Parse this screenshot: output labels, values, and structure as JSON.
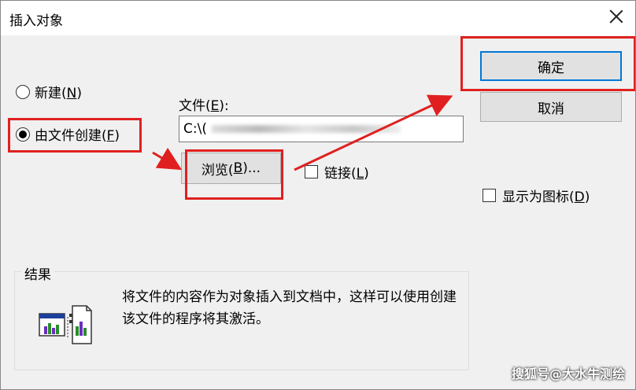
{
  "window": {
    "title": "插入对象"
  },
  "options": {
    "new_label": "新建(",
    "new_key": "N",
    "new_suffix": ")",
    "from_file_label": "由文件创建(",
    "from_file_key": "F",
    "from_file_suffix": ")"
  },
  "file": {
    "label_prefix": "文件(",
    "label_key": "E",
    "label_suffix": "):",
    "value": "C:\\("
  },
  "buttons": {
    "browse_prefix": "浏览(",
    "browse_key": "B",
    "browse_suffix": ")...",
    "ok": "确定",
    "cancel": "取消"
  },
  "checkboxes": {
    "link_prefix": "链接(",
    "link_key": "L",
    "link_suffix": ")",
    "display_icon_prefix": "显示为图标(",
    "display_icon_key": "D",
    "display_icon_suffix": ")"
  },
  "result": {
    "title": "结果",
    "text": "将文件的内容作为对象插入到文档中，这样可以使用创建该文件的程序将其激活。"
  },
  "watermark": "搜狐号@大水牛测绘",
  "colors": {
    "highlight": "#e02020",
    "default_button_border": "#0078d7"
  }
}
